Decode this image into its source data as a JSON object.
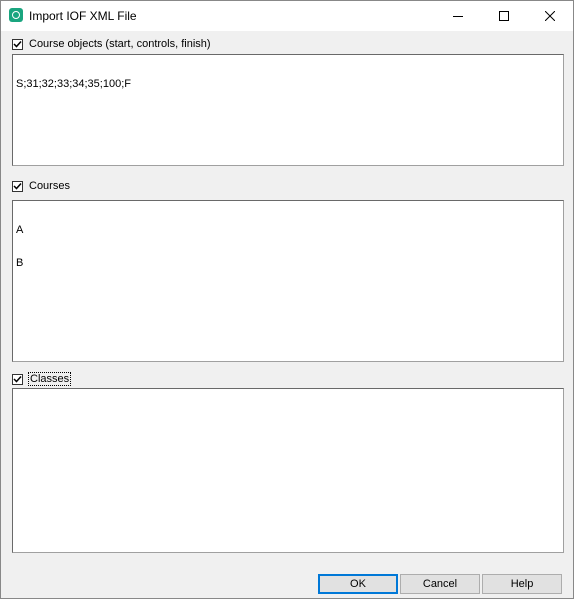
{
  "window": {
    "title": "Import IOF XML File"
  },
  "sections": {
    "course_objects": {
      "label": "Course objects (start, controls, finish)",
      "checked": true,
      "lines": [
        "S;31;32;33;34;35;100;F"
      ]
    },
    "courses": {
      "label": "Courses",
      "checked": true,
      "lines": [
        "A",
        "B"
      ]
    },
    "classes": {
      "label": "Classes",
      "checked": true,
      "lines": []
    }
  },
  "buttons": {
    "ok": "OK",
    "cancel": "Cancel",
    "help": "Help"
  },
  "colors": {
    "app_icon": "#1aa57f",
    "default_button_border": "#0078d7"
  }
}
